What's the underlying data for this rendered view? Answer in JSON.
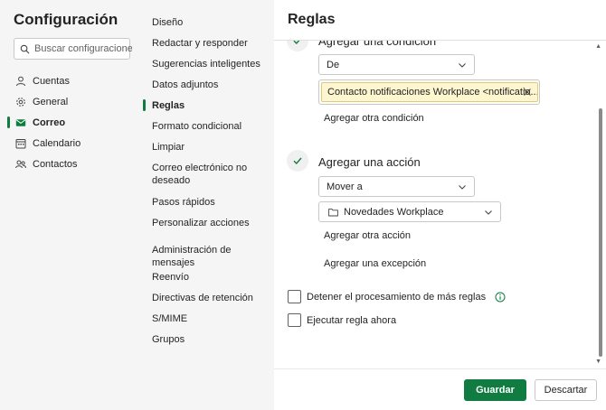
{
  "settings": {
    "title": "Configuración",
    "search_placeholder": "Buscar configuraciones"
  },
  "left_nav": {
    "items": [
      {
        "label": "Cuentas",
        "icon": "person-icon"
      },
      {
        "label": "General",
        "icon": "gear-icon"
      },
      {
        "label": "Correo",
        "icon": "mail-icon",
        "active": true
      },
      {
        "label": "Calendario",
        "icon": "calendar-icon"
      },
      {
        "label": "Contactos",
        "icon": "people-icon"
      }
    ]
  },
  "middle_nav": {
    "items": [
      {
        "label": "Diseño"
      },
      {
        "label": "Redactar y responder"
      },
      {
        "label": "Sugerencias inteligentes"
      },
      {
        "label": "Datos adjuntos"
      },
      {
        "label": "Reglas",
        "active": true
      },
      {
        "label": "Formato condicional"
      },
      {
        "label": "Limpiar"
      },
      {
        "label": "Correo electrónico no deseado"
      },
      {
        "label": "Pasos rápidos"
      },
      {
        "label": "Personalizar acciones"
      },
      {
        "label": "Administración de mensajes"
      },
      {
        "label": "Reenvío"
      },
      {
        "label": "Directivas de retención"
      },
      {
        "label": "S/MIME"
      },
      {
        "label": "Grupos"
      }
    ]
  },
  "rules": {
    "title": "Reglas",
    "condition": {
      "heading": "Agregar una condición",
      "field_value": "De",
      "tag_value": "Contacto notificaciones Workplace <notificatio...",
      "add_another": "Agregar otra condición"
    },
    "action": {
      "heading": "Agregar una acción",
      "action_value": "Mover a",
      "folder_value": "Novedades Workplace",
      "add_another": "Agregar otra acción",
      "add_exception": "Agregar una excepción"
    },
    "stop_processing_label": "Detener el procesamiento de más reglas",
    "run_now_label": "Ejecutar regla ahora"
  },
  "footer": {
    "save_label": "Guardar",
    "discard_label": "Descartar"
  },
  "colors": {
    "accent": "#107c41",
    "tag_bg": "#fdf6cf",
    "pane_bg": "#f5f5f5"
  }
}
